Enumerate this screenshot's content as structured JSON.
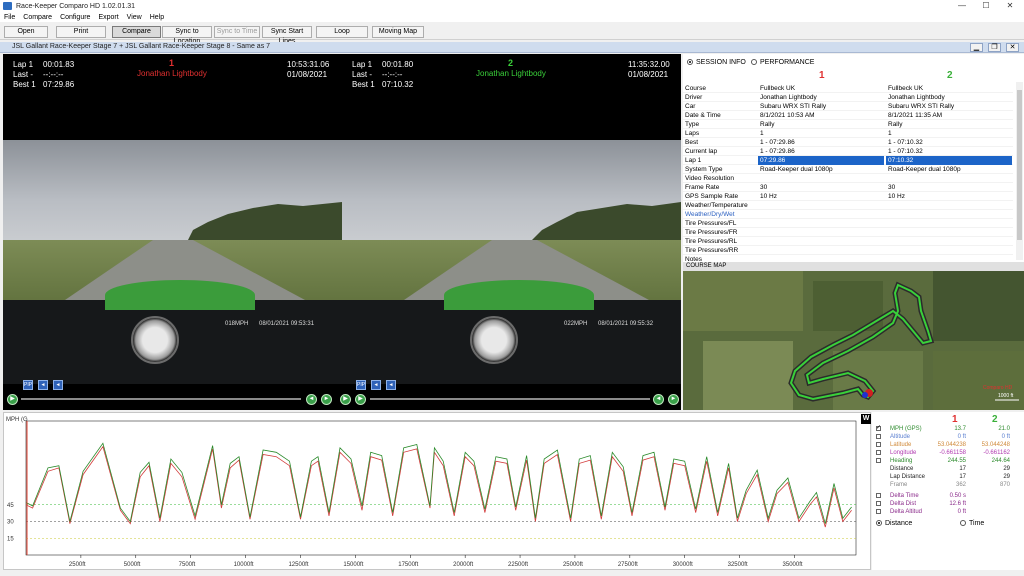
{
  "window": {
    "title": "Race-Keeper Comparo HD 1.02.01.31",
    "minimize": "—",
    "maximize": "☐",
    "close": "✕"
  },
  "menu": [
    "File",
    "Compare",
    "Configure",
    "Export",
    "View",
    "Help"
  ],
  "toolbar": {
    "open": "Open",
    "print": "Print",
    "compare": "Compare",
    "sync_location": "Sync to Location",
    "sync_time": "Sync to Time",
    "sync_start": "Sync Start Lines",
    "loop": "Loop",
    "moving_map": "Moving Map"
  },
  "doc_title": "JSL Gallant Race-Keeper Stage 7 + JSL Gallant Race-Keeper Stage 8 - Same as 7",
  "video": [
    {
      "num": "1",
      "lap_label": "Lap 1",
      "lap_value": "00:01.83",
      "last_label": "Last -",
      "last_value": "--:--:--",
      "best_label": "Best 1",
      "best_value": "07:29.86",
      "driver": "Jonathan Lightbody",
      "time": "10:53:31.06",
      "date": "01/08/2021",
      "driver_color": "#e03030",
      "cam_speed": "018MPH",
      "cam_date": "08/01/2021 09:53:31"
    },
    {
      "num": "2",
      "lap_label": "Lap 1",
      "lap_value": "00:01.80",
      "last_label": "Last -",
      "last_value": "--:--:--",
      "best_label": "Best 1",
      "best_value": "07:10.32",
      "driver": "Jonathan Lightbody",
      "time": "11:35:32.00",
      "date": "01/08/2021",
      "driver_color": "#3ad03a",
      "cam_speed": "022MPH",
      "cam_date": "08/01/2021 09:55:32"
    }
  ],
  "session": {
    "radio_session": "SESSION INFO",
    "radio_performance": "PERFORMANCE",
    "col1": "1",
    "col2": "2",
    "rows": [
      {
        "k": "Course",
        "v1": "Fullbeck UK",
        "v2": "Fullbeck UK"
      },
      {
        "k": "Driver",
        "v1": "Jonathan Lightbody",
        "v2": "Jonathan Lightbody"
      },
      {
        "k": "Car",
        "v1": "Subaru WRX STI Rally",
        "v2": "Subaru WRX STI Rally"
      },
      {
        "k": "Date & Time",
        "v1": "8/1/2021 10:53 AM",
        "v2": "8/1/2021 11:35 AM"
      },
      {
        "k": "Type",
        "v1": "Rally",
        "v2": "Rally"
      },
      {
        "k": "Laps",
        "v1": "1",
        "v2": "1"
      },
      {
        "k": "Best",
        "v1": "1 - 07:29.86",
        "v2": "1 - 07:10.32"
      },
      {
        "k": "Current lap",
        "v1": "1 - 07:29.86",
        "v2": "1 - 07:10.32"
      },
      {
        "k": "Lap 1",
        "v1": "07:29.86",
        "v2": "07:10.32",
        "sel": true
      },
      {
        "k": "System Type",
        "v1": "Road-Keeper dual 1080p",
        "v2": "Road-Keeper dual 1080p"
      },
      {
        "k": "Video Resolution",
        "v1": "",
        "v2": ""
      },
      {
        "k": "Frame Rate",
        "v1": "30",
        "v2": "30"
      },
      {
        "k": "GPS Sample Rate",
        "v1": "10 Hz",
        "v2": "10 Hz"
      },
      {
        "k": "Weather/Temperature",
        "v1": "",
        "v2": ""
      },
      {
        "k": "Weather/Dry/Wet",
        "v1": "",
        "v2": "",
        "link": true
      },
      {
        "k": "Tire Pressures/FL",
        "v1": "",
        "v2": ""
      },
      {
        "k": "Tire Pressures/FR",
        "v1": "",
        "v2": ""
      },
      {
        "k": "Tire Pressures/RL",
        "v1": "",
        "v2": ""
      },
      {
        "k": "Tire Pressures/RR",
        "v1": "",
        "v2": ""
      },
      {
        "k": "Notes",
        "v1": "",
        "v2": ""
      }
    ]
  },
  "map": {
    "title": "COURSE MAP",
    "scale": "1000 ft",
    "legend": "Comparo HD"
  },
  "chart": {
    "ylabel": "MPH (G",
    "w_button": "W"
  },
  "chart_data": {
    "type": "line",
    "xlabel": "",
    "ylabel": "MPH (G",
    "xticks": [
      "2500ft",
      "5000ft",
      "7500ft",
      "10000ft",
      "12500ft",
      "15000ft",
      "17500ft",
      "20000ft",
      "22500ft",
      "25000ft",
      "27500ft",
      "30000ft",
      "32500ft",
      "35000ft"
    ],
    "xtick_values": [
      2500,
      5000,
      7500,
      10000,
      12500,
      15000,
      17500,
      20000,
      22500,
      25000,
      27500,
      30000,
      32500,
      35000
    ],
    "yticks": [
      "15",
      "30",
      "45"
    ],
    "ytick_values": [
      15,
      30,
      45
    ],
    "xlim": [
      0,
      37800
    ],
    "ylim": [
      0,
      120
    ],
    "reference_lines": [
      {
        "y": 45,
        "color": "#34b834"
      },
      {
        "y": 30,
        "color": "#444444"
      },
      {
        "y": 15,
        "color": "#c8c832"
      }
    ],
    "series": [
      {
        "color": "#d23a3a",
        "x": [
          0,
          300,
          1000,
          1500,
          2000,
          2600,
          3500,
          4300,
          4750,
          5200,
          5600,
          6100,
          6600,
          7100,
          7700,
          8500,
          8900,
          9300,
          9700,
          10200,
          10800,
          11400,
          12000,
          12500,
          13000,
          13300,
          13800,
          14300,
          14800,
          15300,
          15700,
          16200,
          16700,
          17200,
          17800,
          18400,
          18600,
          19000,
          19500,
          20000,
          20400,
          20900,
          21400,
          21900,
          22300,
          22800,
          23200,
          23600,
          24200,
          24800,
          25200,
          25700,
          26200,
          26700,
          27200,
          27600,
          28100,
          28600,
          29100,
          29500,
          30000,
          30500,
          31000,
          31500,
          32000,
          32400,
          32800,
          33300,
          33800,
          34200,
          34700,
          35200,
          35700,
          36000,
          36400,
          36800,
          37200,
          37600
        ],
        "y": [
          45,
          42,
          75,
          78,
          28,
          72,
          97,
          40,
          28,
          70,
          80,
          30,
          82,
          70,
          32,
          95,
          42,
          78,
          85,
          32,
          90,
          88,
          80,
          32,
          80,
          84,
          35,
          92,
          82,
          40,
          88,
          85,
          35,
          92,
          95,
          42,
          92,
          80,
          35,
          88,
          80,
          38,
          84,
          82,
          40,
          85,
          30,
          82,
          90,
          30,
          82,
          85,
          32,
          88,
          75,
          35,
          85,
          88,
          40,
          82,
          80,
          38,
          84,
          35,
          78,
          30,
          55,
          72,
          30,
          55,
          65,
          30,
          45,
          52,
          25,
          60,
          30,
          40
        ]
      },
      {
        "color": "#2a8a2a",
        "x": [
          0,
          300,
          1000,
          1500,
          2000,
          2600,
          3500,
          4300,
          4750,
          5200,
          5600,
          6100,
          6600,
          7100,
          7700,
          8500,
          8900,
          9300,
          9700,
          10200,
          10800,
          11400,
          12000,
          12500,
          13000,
          13300,
          13800,
          14300,
          14800,
          15300,
          15700,
          16200,
          16700,
          17200,
          17800,
          18400,
          18600,
          19000,
          19500,
          20000,
          20400,
          20900,
          21400,
          21900,
          22300,
          22800,
          23200,
          23600,
          24200,
          24800,
          25200,
          25700,
          26200,
          26700,
          27200,
          27600,
          28100,
          28600,
          29100,
          29500,
          30000,
          30500,
          31000,
          31500,
          32000,
          32400,
          32800,
          33300,
          33800,
          34200,
          34700,
          35200,
          35700,
          36000,
          36400,
          36800,
          37200,
          37600
        ],
        "y": [
          47,
          44,
          78,
          80,
          30,
          75,
          100,
          42,
          30,
          74,
          83,
          33,
          86,
          74,
          35,
          98,
          45,
          82,
          88,
          34,
          94,
          92,
          84,
          34,
          84,
          88,
          38,
          96,
          86,
          44,
          92,
          89,
          38,
          96,
          99,
          44,
          96,
          84,
          38,
          92,
          84,
          41,
          88,
          86,
          43,
          89,
          33,
          86,
          94,
          33,
          86,
          89,
          35,
          92,
          79,
          38,
          89,
          92,
          43,
          86,
          84,
          41,
          88,
          38,
          82,
          33,
          58,
          76,
          33,
          58,
          69,
          33,
          48,
          56,
          28,
          64,
          33,
          43
        ]
      }
    ]
  },
  "data_panel": {
    "col1": "1",
    "col2": "2",
    "rows": [
      {
        "name": "MPH (GPS)",
        "v1": "13.7",
        "v2": "21.0",
        "checked": true,
        "color": "#2e8b2e"
      },
      {
        "name": "Altitude",
        "v1": "0 ft",
        "v2": "0 ft",
        "checked": false,
        "color": "#5a7fd0"
      },
      {
        "name": "Latitude",
        "v1": "53.044238",
        "v2": "53.044248",
        "checked": false,
        "color": "#d08a3a"
      },
      {
        "name": "Longitude",
        "v1": "-0.661158",
        "v2": "-0.661162",
        "checked": false,
        "color": "#b03ab0"
      },
      {
        "name": "Heading",
        "v1": "244.55",
        "v2": "244.64",
        "checked": false,
        "color": "#2e8b2e"
      },
      {
        "name": "Distance",
        "v1": "17",
        "v2": "29",
        "checked": false,
        "color": "#222222",
        "nocb": true
      },
      {
        "name": "Lap Distance",
        "v1": "17",
        "v2": "29",
        "checked": false,
        "color": "#222222",
        "nocb": true
      },
      {
        "name": "Frame",
        "v1": "362",
        "v2": "870",
        "checked": false,
        "color": "#888888",
        "nocb": true
      },
      {
        "name": "Delta Time",
        "v1": "0.50 s",
        "v2": "",
        "checked": false,
        "color": "#8a2a8a"
      },
      {
        "name": "Delta Dist",
        "v1": "12.6 ft",
        "v2": "",
        "checked": false,
        "color": "#8a2a8a"
      },
      {
        "name": "Delta Altitud",
        "v1": "0 ft",
        "v2": "",
        "checked": false,
        "color": "#8a2a8a"
      }
    ],
    "radio_distance": "Distance",
    "radio_time": "Time"
  }
}
